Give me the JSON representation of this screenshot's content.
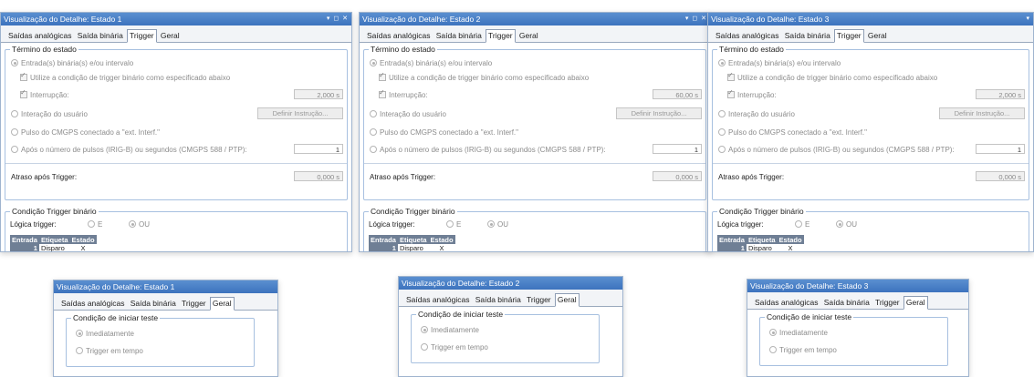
{
  "top_panels": [
    {
      "title": "Visualização do Detalhe: Estado 1",
      "controls": "▾ ◻ ✕",
      "tabs": [
        "Saídas analógicas",
        "Saída binária",
        "Trigger",
        "Geral"
      ],
      "active_tab": "Trigger",
      "termino": {
        "legend": "Término do estado",
        "opt_binaria": "Entrada(s) binária(s) e/ou intervalo",
        "chk_utilize": "Utilize a condição de trigger binário como especificado abaixo",
        "chk_interrupcao": "Interrupção:",
        "interrupcao_value": "2,000 s",
        "opt_interacao": "Interação do usuário",
        "btn_define": "Definir Instrução...",
        "opt_pulso": "Pulso do CMGPS conectado a \"ext. Interf.\"",
        "opt_apos": "Após o número de pulsos (IRIG-B) ou segundos (CMGPS 588 / PTP):",
        "apos_value": "1"
      },
      "atraso": {
        "label": "Atraso após Trigger:",
        "value": "0,000 s"
      },
      "condicao": {
        "legend": "Condição Trigger binário",
        "logica_label": "Lógica trigger:",
        "opt_e": "E",
        "opt_ou": "OU",
        "table": {
          "headers": [
            "Entrada",
            "Etiqueta",
            "Estado"
          ],
          "rows": [
            {
              "num": "1",
              "etiqueta": "Disparo",
              "estado": "X"
            }
          ]
        }
      }
    },
    {
      "title": "Visualização do Detalhe: Estado 2",
      "controls": "▾ ◻ ✕",
      "tabs": [
        "Saídas analógicas",
        "Saída binária",
        "Trigger",
        "Geral"
      ],
      "active_tab": "Trigger",
      "termino": {
        "legend": "Término do estado",
        "opt_binaria": "Entrada(s) binária(s) e/ou intervalo",
        "chk_utilize": "Utilize a condição de trigger binário como especificado abaixo",
        "chk_interrupcao": "Interrupção:",
        "interrupcao_value": "60,00 s",
        "opt_interacao": "Interação do usuário",
        "btn_define": "Definir Instrução...",
        "opt_pulso": "Pulso do CMGPS conectado a \"ext. Interf.\"",
        "opt_apos": "Após o número de pulsos (IRIG-B) ou segundos (CMGPS 588 / PTP):",
        "apos_value": "1"
      },
      "atraso": {
        "label": "Atraso após Trigger:",
        "value": "0,000 s"
      },
      "condicao": {
        "legend": "Condição Trigger binário",
        "logica_label": "Lógica trigger:",
        "opt_e": "E",
        "opt_ou": "OU",
        "table": {
          "headers": [
            "Entrada",
            "Etiqueta",
            "Estado"
          ],
          "rows": [
            {
              "num": "1",
              "etiqueta": "Disparo",
              "estado": "X"
            }
          ]
        }
      }
    },
    {
      "title": "Visualização do Detalhe: Estado 3",
      "controls": "▾",
      "tabs": [
        "Saídas analógicas",
        "Saída binária",
        "Trigger",
        "Geral"
      ],
      "active_tab": "Trigger",
      "termino": {
        "legend": "Término do estado",
        "opt_binaria": "Entrada(s) binária(s) e/ou intervalo",
        "chk_utilize": "Utilize a condição de trigger binário como especificado abaixo",
        "chk_interrupcao": "Interrupção:",
        "interrupcao_value": "2,000 s",
        "opt_interacao": "Interação do usuário",
        "btn_define": "Definir Instrução...",
        "opt_pulso": "Pulso do CMGPS conectado a \"ext. Interf.\"",
        "opt_apos": "Após o número de pulsos (IRIG-B) ou segundos (CMGPS 588 / PTP):",
        "apos_value": "1"
      },
      "atraso": {
        "label": "Atraso após Trigger:",
        "value": "0,000 s"
      },
      "condicao": {
        "legend": "Condição Trigger binário",
        "logica_label": "Lógica trigger:",
        "opt_e": "E",
        "opt_ou": "OU",
        "table": {
          "headers": [
            "Entrada",
            "Etiqueta",
            "Estado"
          ],
          "rows": [
            {
              "num": "1",
              "etiqueta": "Disparo",
              "estado": "X"
            }
          ]
        }
      }
    }
  ],
  "bottom_panels": [
    {
      "title": "Visualização do Detalhe: Estado 1",
      "tabs": [
        "Saídas analógicas",
        "Saída binária",
        "Trigger",
        "Geral"
      ],
      "active_tab": "Geral",
      "legend": "Condição de iniciar teste",
      "opt_imediatamente": "Imediatamente",
      "opt_trigger_tempo": "Trigger em tempo"
    },
    {
      "title": "Visualização do Detalhe: Estado 2",
      "tabs": [
        "Saídas analógicas",
        "Saída binária",
        "Trigger",
        "Geral"
      ],
      "active_tab": "Geral",
      "legend": "Condição de iniciar teste",
      "opt_imediatamente": "Imediatamente",
      "opt_trigger_tempo": "Trigger em tempo"
    },
    {
      "title": "Visualização do Detalhe: Estado 3",
      "tabs": [
        "Saídas analógicas",
        "Saída binária",
        "Trigger",
        "Geral"
      ],
      "active_tab": "Geral",
      "legend": "Condição de iniciar teste",
      "opt_imediatamente": "Imediatamente",
      "opt_trigger_tempo": "Trigger em tempo"
    }
  ]
}
